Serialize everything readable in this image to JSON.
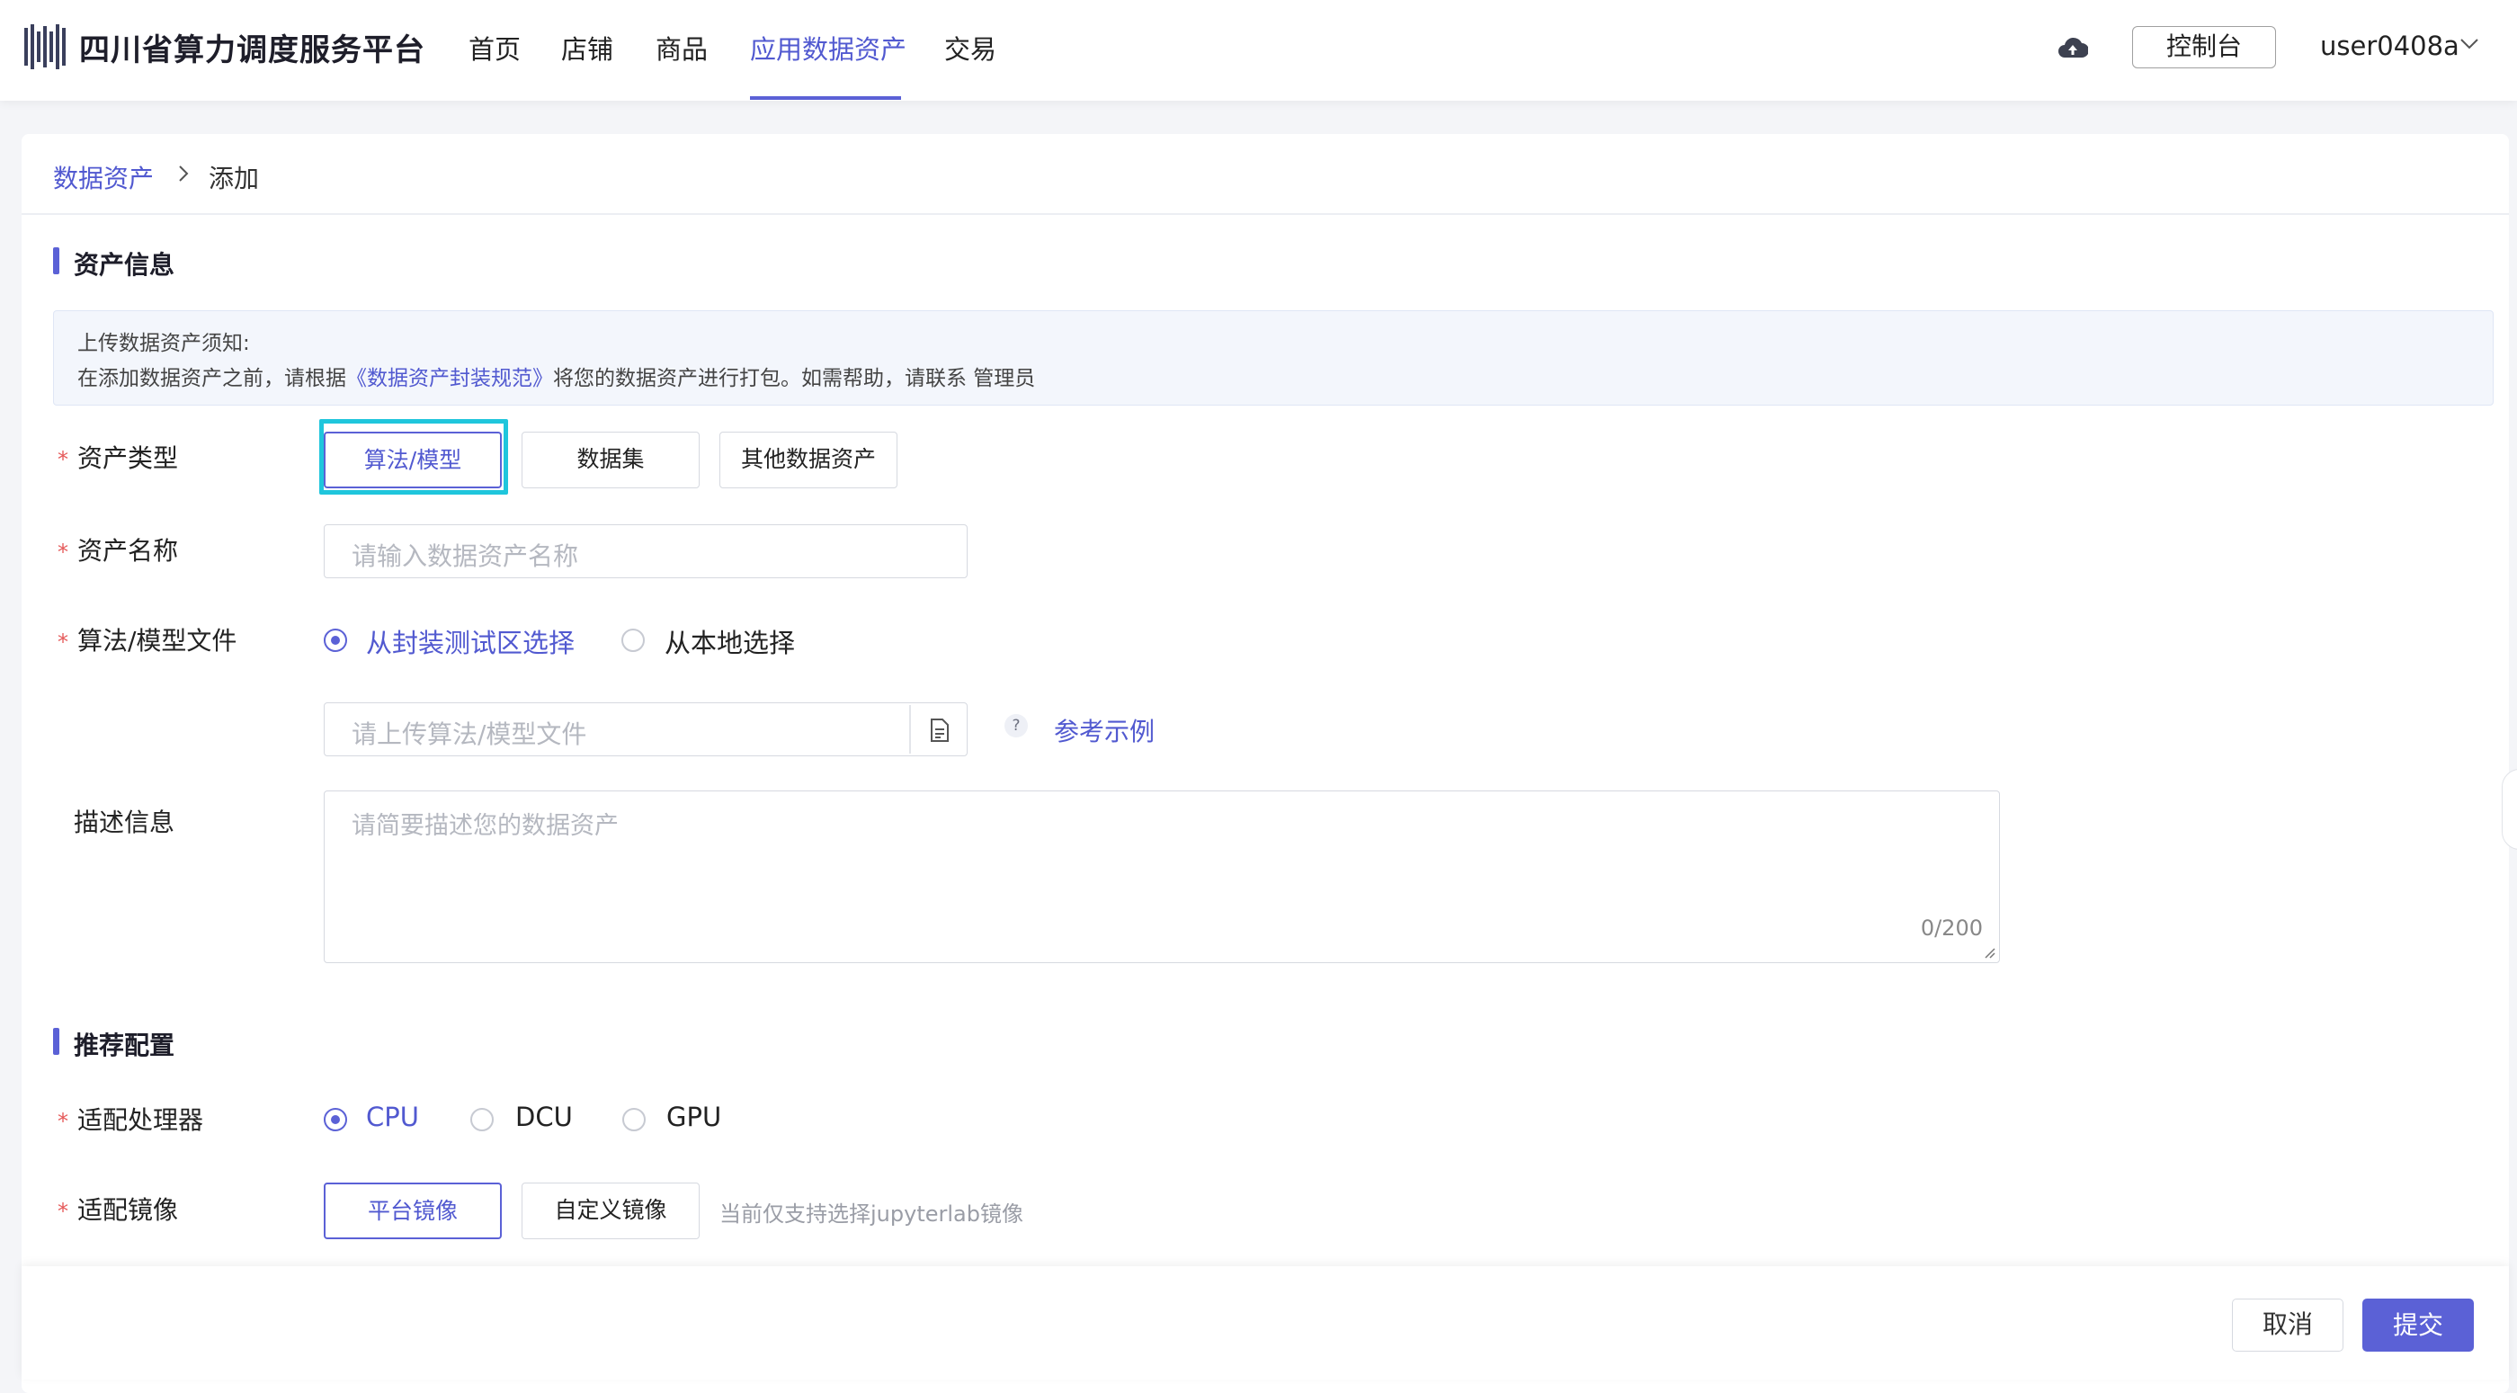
{
  "header": {
    "brand": "四川省算力调度服务平台",
    "nav": [
      "首页",
      "店铺",
      "商品",
      "应用数据资产",
      "交易"
    ],
    "active_nav": "应用数据资产",
    "console_label": "控制台",
    "username": "user0408a"
  },
  "breadcrumb": {
    "parent": "数据资产",
    "current": "添加"
  },
  "section_asset": {
    "title": "资产信息",
    "notice_title": "上传数据资产须知:",
    "notice_prefix": "在添加数据资产之前，请根据",
    "notice_link": "《数据资产封装规范》",
    "notice_suffix": "将您的数据资产进行打包。如需帮助，请联系 管理员",
    "asset_type": {
      "label": "资产类型",
      "options": [
        "算法/模型",
        "数据集",
        "其他数据资产"
      ],
      "selected": "算法/模型"
    },
    "asset_name": {
      "label": "资产名称",
      "placeholder": "请输入数据资产名称"
    },
    "model_file": {
      "label": "算法/模型文件",
      "radio_options": [
        "从封装测试区选择",
        "从本地选择"
      ],
      "selected": "从封装测试区选择",
      "placeholder": "请上传算法/模型文件",
      "help": "?",
      "reference_link": "参考示例"
    },
    "description": {
      "label": "描述信息",
      "placeholder": "请简要描述您的数据资产",
      "counter": "0/200"
    }
  },
  "section_config": {
    "title": "推荐配置",
    "processor": {
      "label": "适配处理器",
      "options": [
        "CPU",
        "DCU",
        "GPU"
      ],
      "selected": "CPU"
    },
    "image": {
      "label": "适配镜像",
      "options": [
        "平台镜像",
        "自定义镜像"
      ],
      "selected": "平台镜像",
      "hint": "当前仅支持选择jupyterlab镜像"
    }
  },
  "footer": {
    "cancel": "取消",
    "submit": "提交"
  },
  "colors": {
    "accent": "#5b61d6",
    "highlight": "#1fc6dc",
    "required": "#e55a5a"
  },
  "icons": [
    "logo-icon",
    "cloud-upload-icon",
    "chevron-down-icon",
    "chevron-right-icon",
    "file-icon",
    "help-icon"
  ]
}
